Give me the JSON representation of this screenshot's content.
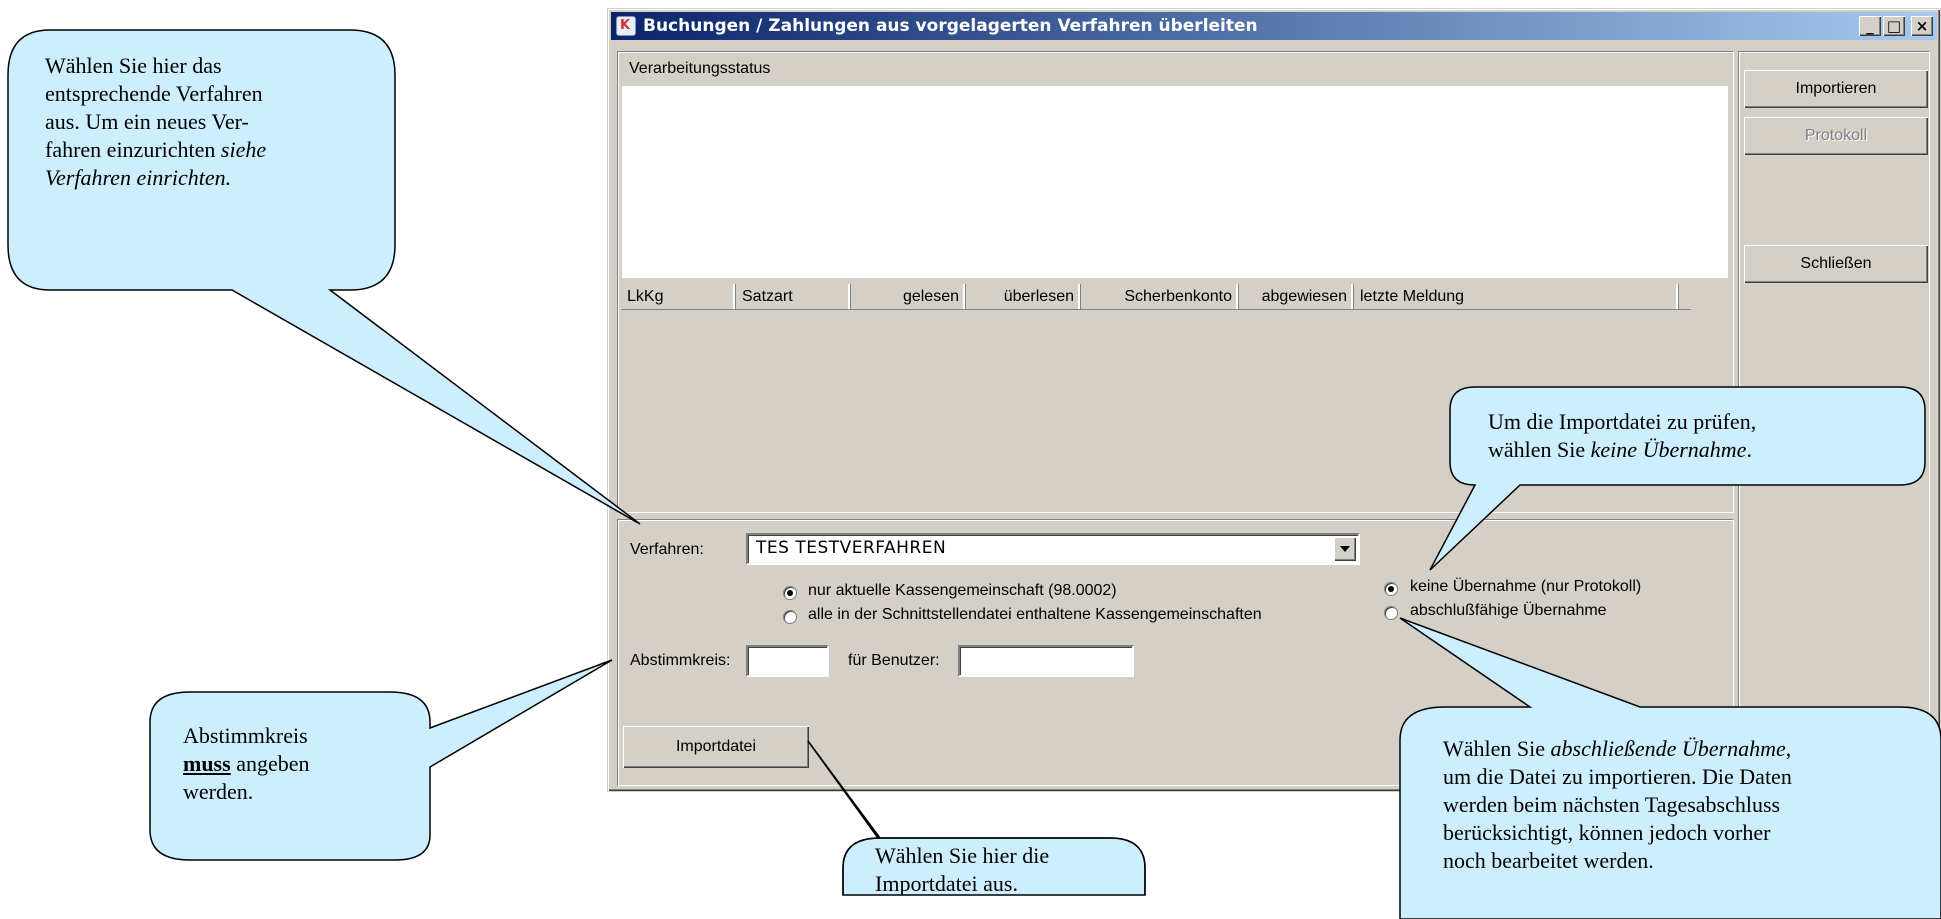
{
  "window": {
    "title": "Buchungen / Zahlungen aus vorgelagerten Verfahren überleiten",
    "controls": {
      "minimize": "_",
      "maximize": "□",
      "close": "×"
    }
  },
  "status_section": {
    "label": "Verarbeitungsstatus"
  },
  "table": {
    "columns": [
      "LkKg",
      "Satzart",
      "gelesen",
      "überlesen",
      "Scherbenkonto",
      "abgewiesen",
      "letzte Meldung"
    ]
  },
  "right_buttons": {
    "import_label": "Importieren",
    "protocol_label": "Protokoll",
    "close_label": "Schließen"
  },
  "form": {
    "verfahren_label": "Verfahren:",
    "verfahren_value": "TES  TESTVERFAHREN",
    "scope_options": [
      "nur aktuelle Kassengemeinschaft (98.0002)",
      "alle in der Schnittstellendatei enthaltene Kassengemeinschaften"
    ],
    "mode_options": [
      "keine Übernahme (nur Protokoll)",
      "abschlußfähige Übernahme"
    ],
    "abstimmkreis_label": "Abstimmkreis:",
    "abstimmkreis_value": "",
    "benutzer_label": "für Benutzer:",
    "benutzer_value": "",
    "importdatei_button": "Importdatei"
  },
  "callouts": {
    "verfahren": {
      "line1": "Wählen Sie hier das",
      "line2": "entsprechende Verfahren",
      "line3": "aus. Um ein neues Ver-",
      "line4_plain": "fahren einzurichten ",
      "line4_italic": "siehe",
      "line5_italic": "Verfahren einrichten."
    },
    "abstimmkreis": {
      "line1": "Abstimmkreis",
      "line2_bold": "muss",
      "line2_rest": " angeben",
      "line3": "werden."
    },
    "importdatei": {
      "line1": "Wählen Sie hier die",
      "line2": "Importdatei aus."
    },
    "keine_uebernahme": {
      "line1": "Um die Importdatei zu prüfen,",
      "line2_plain": "wählen Sie ",
      "line2_italic": "keine Übernahme",
      "line2_end": "."
    },
    "abschliessend": {
      "line1_plain": "Wählen Sie ",
      "line1_italic": "abschließende Übernahme",
      "line1_end": ",",
      "line2": "um die Datei zu importieren. Die Daten",
      "line3": "werden beim nächsten Tagesabschluss",
      "line4": "berücksichtigt, können jedoch vorher",
      "line5": "noch bearbeitet werden."
    }
  }
}
